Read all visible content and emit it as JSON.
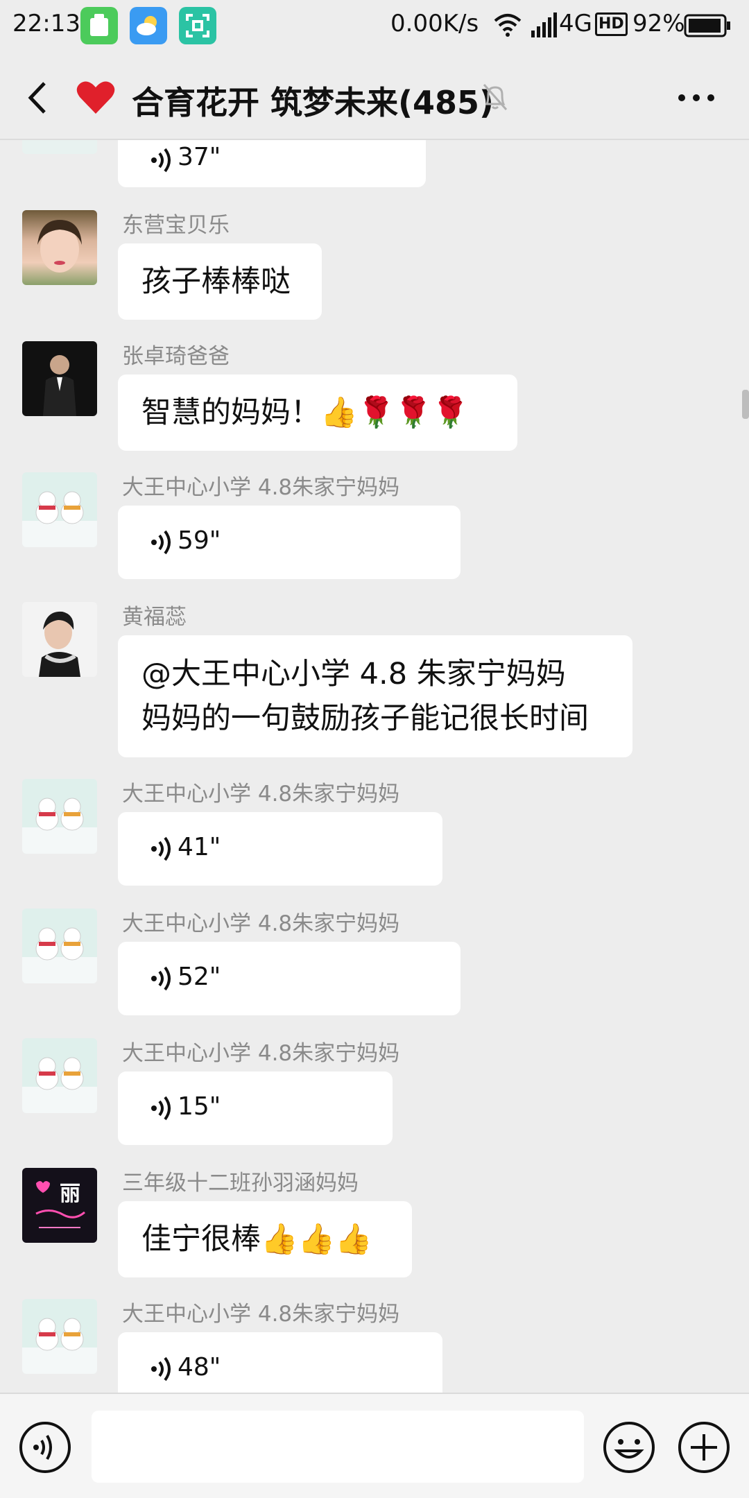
{
  "statusbar": {
    "time": "22:13",
    "net_speed": "0.00K/s",
    "network": "4G",
    "hd": "HD",
    "battery": "92%"
  },
  "header": {
    "title": "合育花开 筑梦未来(485)",
    "heart_icon": "heart-icon",
    "accent": "#E0202B"
  },
  "messages": [
    {
      "type": "voice",
      "duration": "37\""
    },
    {
      "type": "text",
      "sender": "东营宝贝乐",
      "text": "孩子棒棒哒"
    },
    {
      "type": "text",
      "sender": "张卓琦爸爸",
      "text": "智慧的妈妈！👍🌹🌹🌹"
    },
    {
      "type": "voice",
      "sender": "大王中心小学 4.8朱家宁妈妈",
      "duration": "59\""
    },
    {
      "type": "text",
      "sender": "黄福蕊",
      "lines": [
        "@大王中心小学 4.8 朱家宁妈妈",
        "妈妈的一句鼓励孩子能记很长时间"
      ]
    },
    {
      "type": "voice",
      "sender": "大王中心小学 4.8朱家宁妈妈",
      "duration": "41\""
    },
    {
      "type": "voice",
      "sender": "大王中心小学 4.8朱家宁妈妈",
      "duration": "52\""
    },
    {
      "type": "voice",
      "sender": "大王中心小学 4.8朱家宁妈妈",
      "duration": "15\""
    },
    {
      "type": "text",
      "sender": "三年级十二班孙羽涵妈妈",
      "text": "佳宁很棒👍👍👍"
    },
    {
      "type": "voice",
      "sender": "大王中心小学 4.8朱家宁妈妈",
      "duration": "48\""
    }
  ],
  "avatar_badge_text": "丽",
  "input": {
    "placeholder": ""
  }
}
